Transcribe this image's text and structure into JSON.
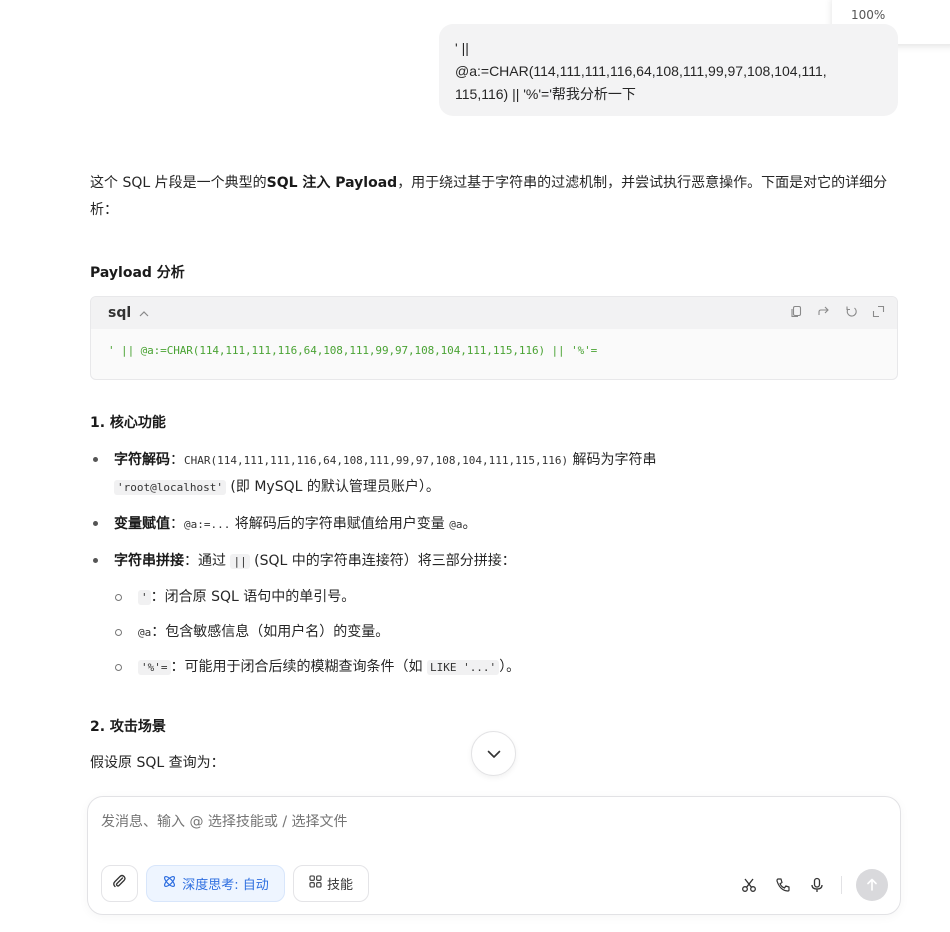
{
  "zoom": "100%",
  "user_message": {
    "lines": [
      "' ||",
      "@a:=CHAR(114,111,111,116,64,108,111,99,97,108,104,111,",
      "115,116) || '%'='帮我分析一下"
    ]
  },
  "reply": {
    "intro": {
      "part1": "这个 SQL 片段是一个典型的",
      "bold": "SQL 注入 Payload",
      "part2": "，用于绕过基于字符串的过滤机制，并尝试执行恶意操作。下面是对它的详细分析："
    },
    "section1_title": "Payload 分析",
    "code_block": {
      "language": "sql",
      "caret": "^",
      "code": "' || @a:=CHAR(114,111,111,116,64,108,111,99,97,108,104,111,115,116) || '%'=",
      "tools": [
        "copy-icon",
        "share-icon",
        "run-icon",
        "expand-icon"
      ]
    },
    "section2_title": "1. 核心功能",
    "bullets": {
      "b1_label": "字符解码",
      "b1_colon": "：",
      "b1_code": "CHAR(114,111,111,116,64,108,111,99,97,108,104,111,115,116)",
      "b1_text": " 解码为字符串",
      "b1_code2": "'root@localhost'",
      "b1_text2": " (即 MySQL 的默认管理员账户）。",
      "b2_label": "变量赋值",
      "b2_colon": "：",
      "b2_code": "@a:=...",
      "b2_text": " 将解码后的字符串赋值给用户变量 ",
      "b2_code2": "@a",
      "b2_end": "。",
      "b3_label": "字符串拼接",
      "b3_text": "：通过 ",
      "b3_code": "||",
      "b3_text2": " (SQL 中的字符串连接符）将三部分拼接：",
      "sub1_code": "'",
      "sub1_text": "：闭合原 SQL 语句中的单引号。",
      "sub2_code": "@a",
      "sub2_text": "：包含敏感信息（如用户名）的变量。",
      "sub3_code": "'%'=",
      "sub3_text": "：可能用于闭合后续的模糊查询条件（如 ",
      "sub3_code2": "LIKE '...'",
      "sub3_end": "）。"
    },
    "section3_title": "2. 攻击场景",
    "para2": "假设原 SQL 查询为："
  },
  "composer": {
    "placeholder": "发消息、输入 @ 选择技能或 / 选择文件",
    "think_label": "深度思考: 自动",
    "skill_label": "技能"
  },
  "colors": {
    "accent_blue": "#2f6fe0",
    "code_green": "#4aa334",
    "bubble_bg": "#f3f3f4"
  }
}
